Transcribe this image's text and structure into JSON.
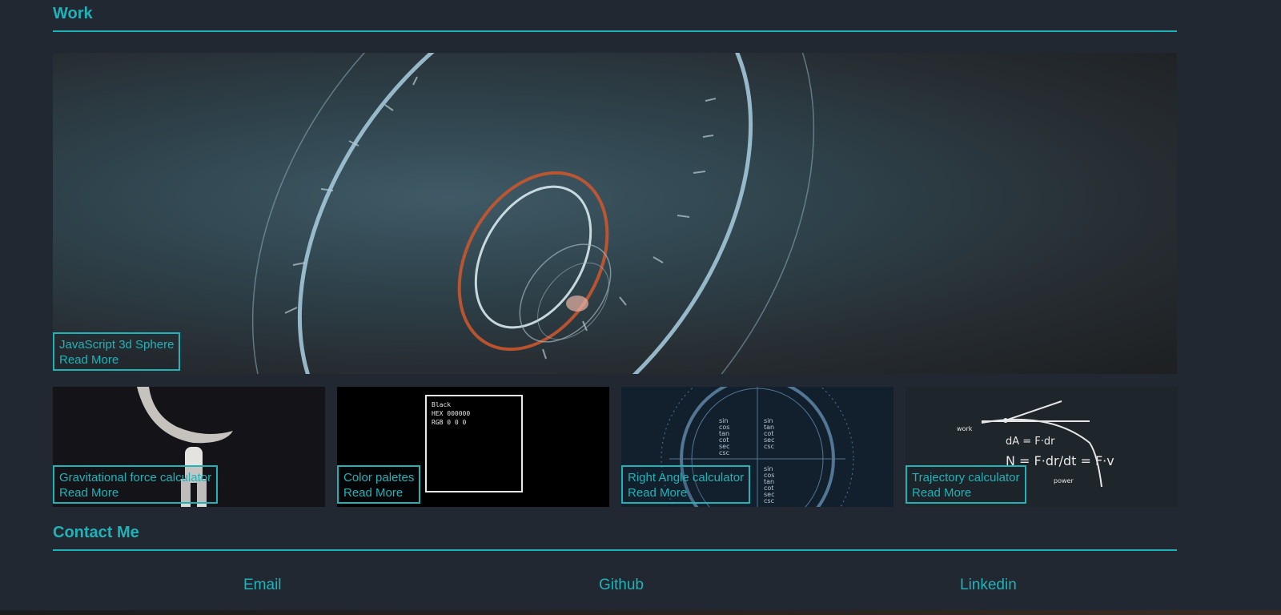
{
  "work": {
    "title": "Work",
    "hero": {
      "title": "JavaScript 3d Sphere",
      "link": "Read More"
    },
    "thumbs": [
      {
        "title": "Gravitational force calculator",
        "link": "Read More"
      },
      {
        "title": "Color paletes",
        "link": "Read More"
      },
      {
        "title": "Right Angle calculator",
        "link": "Read More"
      },
      {
        "title": "Trajectory calculator",
        "link": "Read More"
      }
    ],
    "color_palette_preview": {
      "name": "Black",
      "hex": "HEX 000000",
      "rgb": "RGB 0 0 0"
    }
  },
  "contact": {
    "title": "Contact Me",
    "links": [
      "Email",
      "Github",
      "Linkedin"
    ]
  },
  "colors": {
    "accent": "#1fb3b8",
    "background": "#222831"
  }
}
